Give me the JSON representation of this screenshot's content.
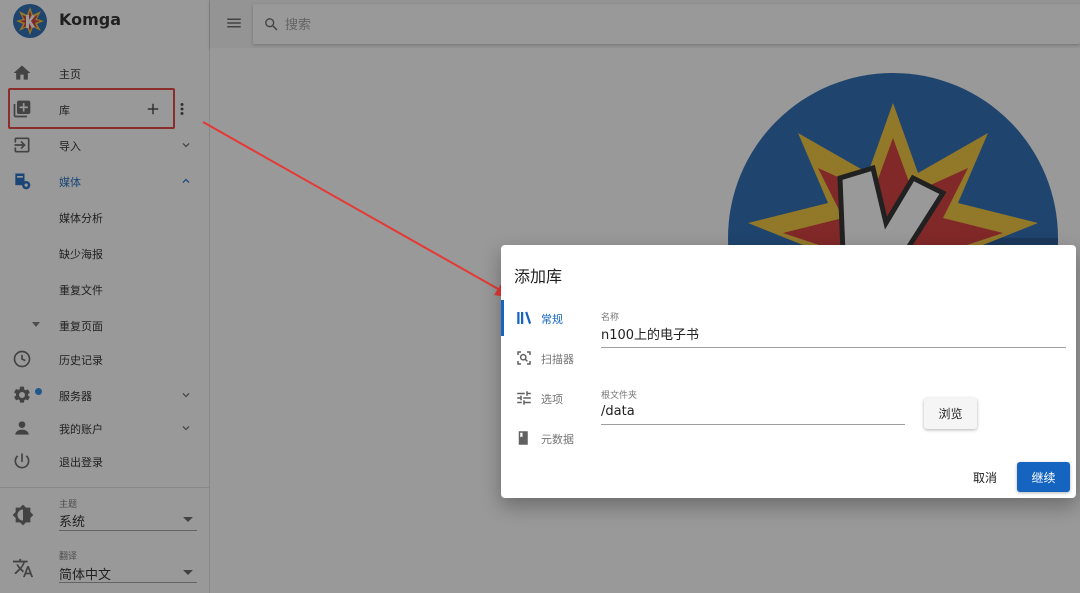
{
  "app": {
    "name": "Komga"
  },
  "search": {
    "placeholder": "搜索",
    "value": ""
  },
  "nav": {
    "home": "主页",
    "libraries": "库",
    "import": "导入",
    "media": "媒体",
    "media_analysis": "媒体分析",
    "missing_posters": "缺少海报",
    "duplicate_files": "重复文件",
    "duplicate_pages": "重复页面",
    "history": "历史记录",
    "server": "服务器",
    "account": "我的账户",
    "logout": "退出登录"
  },
  "theme": {
    "caption": "主题",
    "value": "系统"
  },
  "language": {
    "caption": "翻译",
    "value": "简体中文"
  },
  "dialog": {
    "title": "添加库",
    "tabs": [
      {
        "label": "常规",
        "icon": "books-icon",
        "active": true
      },
      {
        "label": "扫描器",
        "icon": "scanner-icon",
        "active": false
      },
      {
        "label": "选项",
        "icon": "tune-icon",
        "active": false
      },
      {
        "label": "元数据",
        "icon": "metadata-icon",
        "active": false
      }
    ],
    "name_caption": "名称",
    "name_value": "n100上的电子书",
    "root_caption": "根文件夹",
    "root_value": "/data",
    "browse_label": "浏览",
    "cancel_label": "取消",
    "continue_label": "继续"
  },
  "colors": {
    "accent": "#1565c0",
    "highlight_box": "#e53935",
    "arrow": "#e53935",
    "status_dot": "#1e88e5"
  }
}
